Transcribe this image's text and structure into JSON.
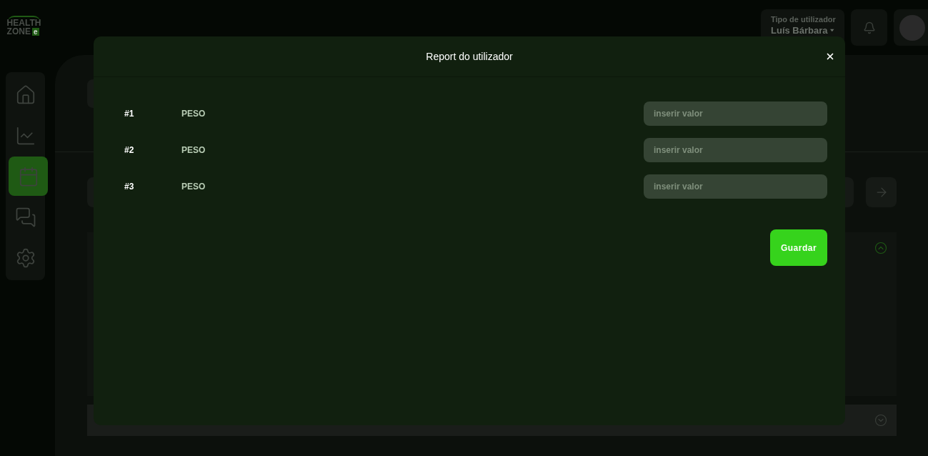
{
  "logo": {
    "line1": "HEALTH",
    "line2": "ZONE",
    "badge": "e"
  },
  "sidebar": {
    "items": [
      {
        "kind": "home",
        "selected": false
      },
      {
        "kind": "stats",
        "selected": false
      },
      {
        "kind": "calendar",
        "selected": true
      },
      {
        "kind": "messages",
        "selected": false
      },
      {
        "kind": "settings",
        "selected": false
      }
    ]
  },
  "user": {
    "role_label": "Tipo de utilizador",
    "name": "Luís Bárbara"
  },
  "modal": {
    "title": "Report do utilizador",
    "rows": [
      {
        "number": "#1",
        "label": "PESO",
        "placeholder": "inserir valor"
      },
      {
        "number": "#2",
        "label": "PESO",
        "placeholder": "inserir valor"
      },
      {
        "number": "#3",
        "label": "PESO",
        "placeholder": "inserir valor"
      }
    ],
    "save_button": "Guardar"
  }
}
